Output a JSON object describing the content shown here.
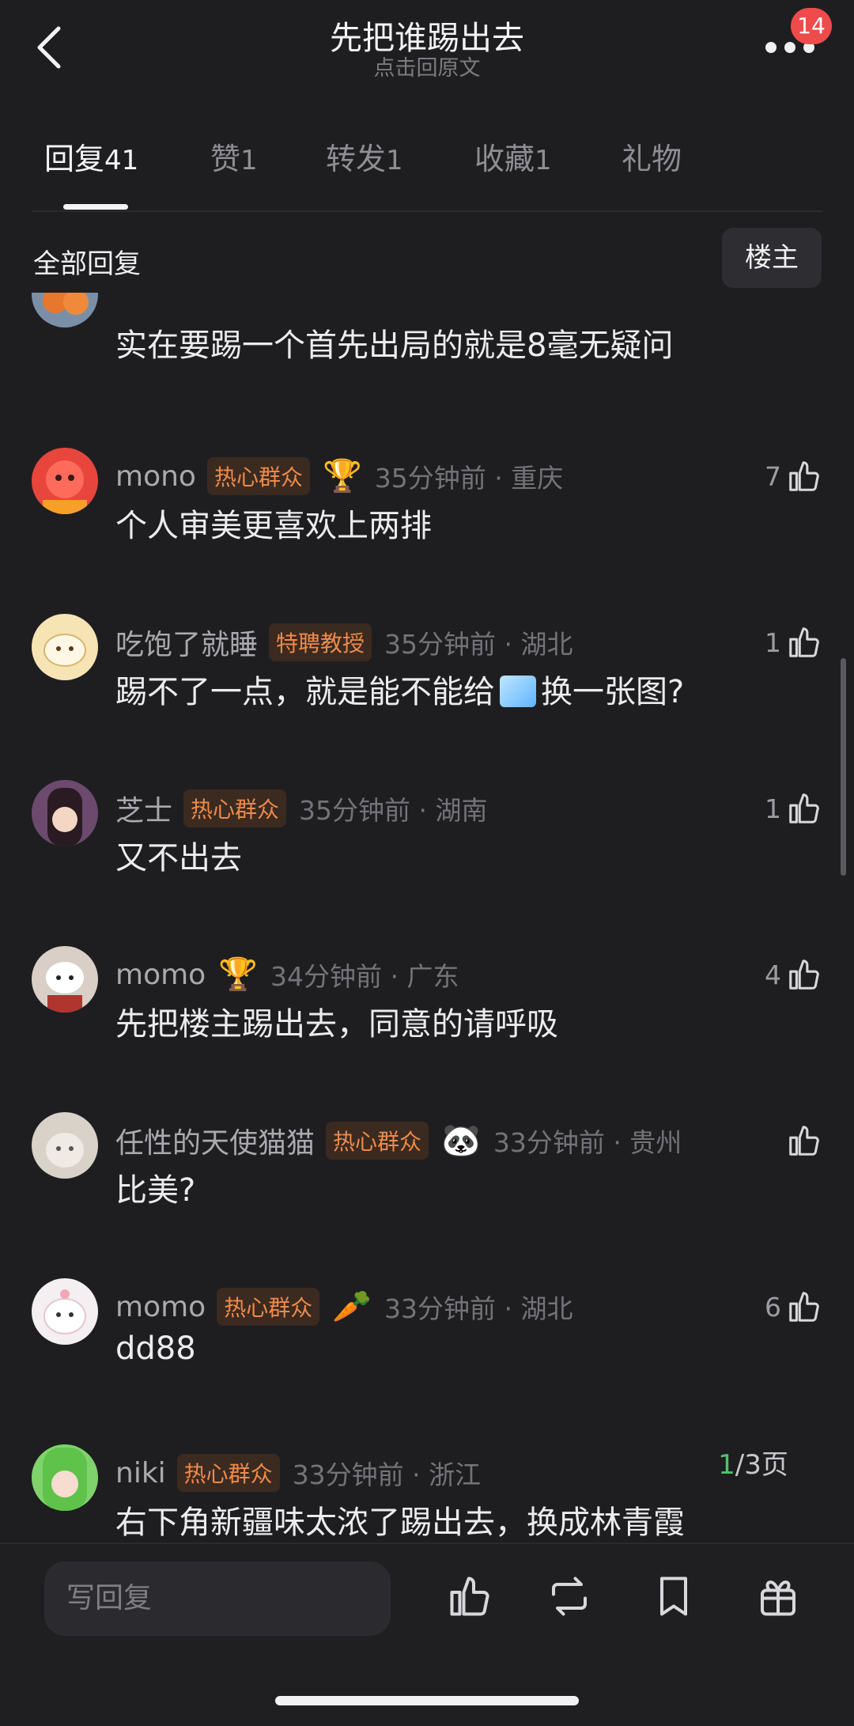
{
  "header": {
    "title": "先把谁踢出去",
    "subtitle": "点击回原文",
    "badge_count": "14"
  },
  "tabs": [
    {
      "label": "回复",
      "count": "41"
    },
    {
      "label": "赞",
      "count": "1"
    },
    {
      "label": "转发",
      "count": "1"
    },
    {
      "label": "收藏",
      "count": "1"
    },
    {
      "label": "礼物",
      "count": ""
    }
  ],
  "section": {
    "all_label": "全部回复",
    "owner_button": "楼主"
  },
  "comments": [
    {
      "name": "",
      "tag": "",
      "medal": "",
      "time": "",
      "likes": "",
      "text": "实在要踢一个首先出局的就是8毫无疑问",
      "avatar_color": "#7a8fa6"
    },
    {
      "name": "mono",
      "tag": "热心群众",
      "medal": "🏆",
      "time": "35分钟前 · 重庆",
      "likes": "7",
      "text": "个人审美更喜欢上两排",
      "avatar_color": "#e8453c"
    },
    {
      "name": "吃饱了就睡",
      "tag": "特聘教授",
      "medal": "",
      "time": "35分钟前 · 湖北",
      "likes": "1",
      "text_before": "踢不了一点，就是能不能给",
      "text_after": "换一张图?",
      "avatar_color": "#f6e4b5"
    },
    {
      "name": "芝士",
      "tag": "热心群众",
      "medal": "",
      "time": "35分钟前 · 湖南",
      "likes": "1",
      "text": "又不出去",
      "avatar_color": "#6b4a6e"
    },
    {
      "name": "momo",
      "tag": "",
      "medal": "🏆",
      "time": "34分钟前 · 广东",
      "likes": "4",
      "text": "先把楼主踢出去，同意的请呼吸",
      "avatar_color": "#d9cfc6"
    },
    {
      "name": "任性的天使猫猫",
      "tag": "热心群众",
      "medal": "🐼",
      "time": "33分钟前 · 贵州",
      "likes": "",
      "text": "比美?",
      "avatar_color": "#d8d2c8"
    },
    {
      "name": "momo",
      "tag": "热心群众",
      "medal": "🥕",
      "time": "33分钟前 · 湖北",
      "likes": "6",
      "text": "dd88",
      "avatar_color": "#f4f0f2"
    },
    {
      "name": "niki",
      "tag": "热心群众",
      "medal": "",
      "time": "33分钟前 · 浙江",
      "likes": "",
      "text": "右下角新疆味太浓了踢出去，换成林青霞",
      "avatar_color": "#7fd36b"
    }
  ],
  "pager": {
    "current": "1",
    "rest": "/3页"
  },
  "bottom_bar": {
    "reply_placeholder": "写回复"
  },
  "colors": {
    "accent_tag": "#ef8a4a",
    "badge": "#ef4b4b",
    "pager_current": "#4fc46a"
  },
  "icons": [
    "back-icon",
    "more-icon",
    "like-icon",
    "repost-icon",
    "bookmark-icon",
    "gift-icon"
  ]
}
